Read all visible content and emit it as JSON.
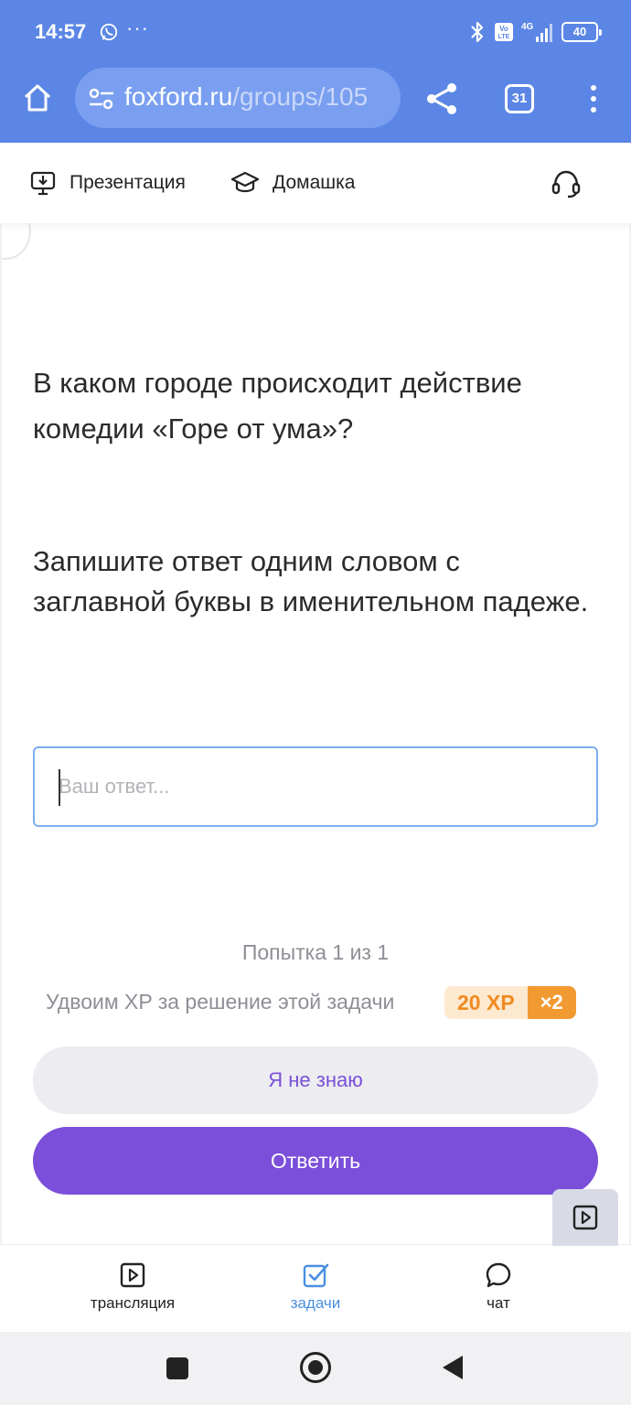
{
  "status_bar": {
    "time": "14:57",
    "more": "···",
    "network": "4G",
    "volte": "Vo LTE",
    "battery": "40"
  },
  "browser": {
    "url_domain": "foxford.ru",
    "url_path": "/groups/105",
    "tab_count": "31",
    "accent_color": "#5b86e5"
  },
  "page_toolbar": {
    "presentation_label": "Презентация",
    "homework_label": "Домашка"
  },
  "task": {
    "question": "В каком городе происходит действие комедии «Горе от ума»?",
    "instruction": "Запишите ответ одним словом с заглавной буквы в именительном падеже.",
    "answer_placeholder": "Ваш ответ...",
    "answer_value": "",
    "attempt_text": "Попытка 1 из 1",
    "xp_text": "Удвоим XP за решение этой задачи",
    "xp_value": "20 XP",
    "xp_multiplier": "×2",
    "dont_know_label": "Я не знаю",
    "answer_label": "Ответить",
    "primary_color": "#7b4fd9"
  },
  "bottom_tabs": [
    {
      "label": "трансляция",
      "icon": "play-square-icon",
      "active": false
    },
    {
      "label": "задачи",
      "icon": "checkbox-icon",
      "active": true
    },
    {
      "label": "чат",
      "icon": "chat-bubble-icon",
      "active": false
    }
  ],
  "system_nav": {
    "icons": [
      "recents-icon",
      "home-icon",
      "back-icon"
    ]
  }
}
